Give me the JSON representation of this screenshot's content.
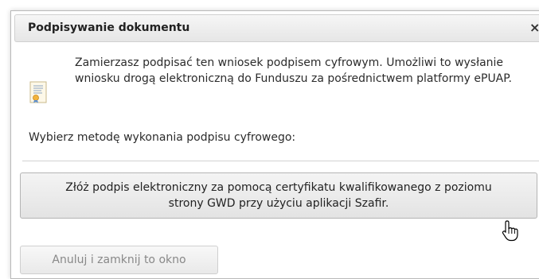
{
  "dialog": {
    "title": "Podpisywanie dokumentu",
    "close_symbol": "×",
    "message": "Zamierzasz podpisać ten wniosek podpisem cyfrowym. Umożliwi to wysłanie wniosku drogą elektroniczną do Funduszu za pośrednictwem platformy ePUAP.",
    "prompt": "Wybierz metodę wykonania podpisu cyfrowego:",
    "sign_button_label": "Złóż podpis elektroniczny za pomocą certyfikatu kwalifikowanego z poziomu strony GWD przy użyciu aplikacji Szafir.",
    "cancel_button_label": "Anuluj i zamknij to okno",
    "icons": {
      "document": "certificate-document-icon",
      "close": "close-icon",
      "cursor": "hand-pointer-icon"
    },
    "colors": {
      "title_bar": "#ececec",
      "border": "#b9b9b9",
      "text": "#2b2b2b",
      "disabled_text": "#888888"
    }
  }
}
